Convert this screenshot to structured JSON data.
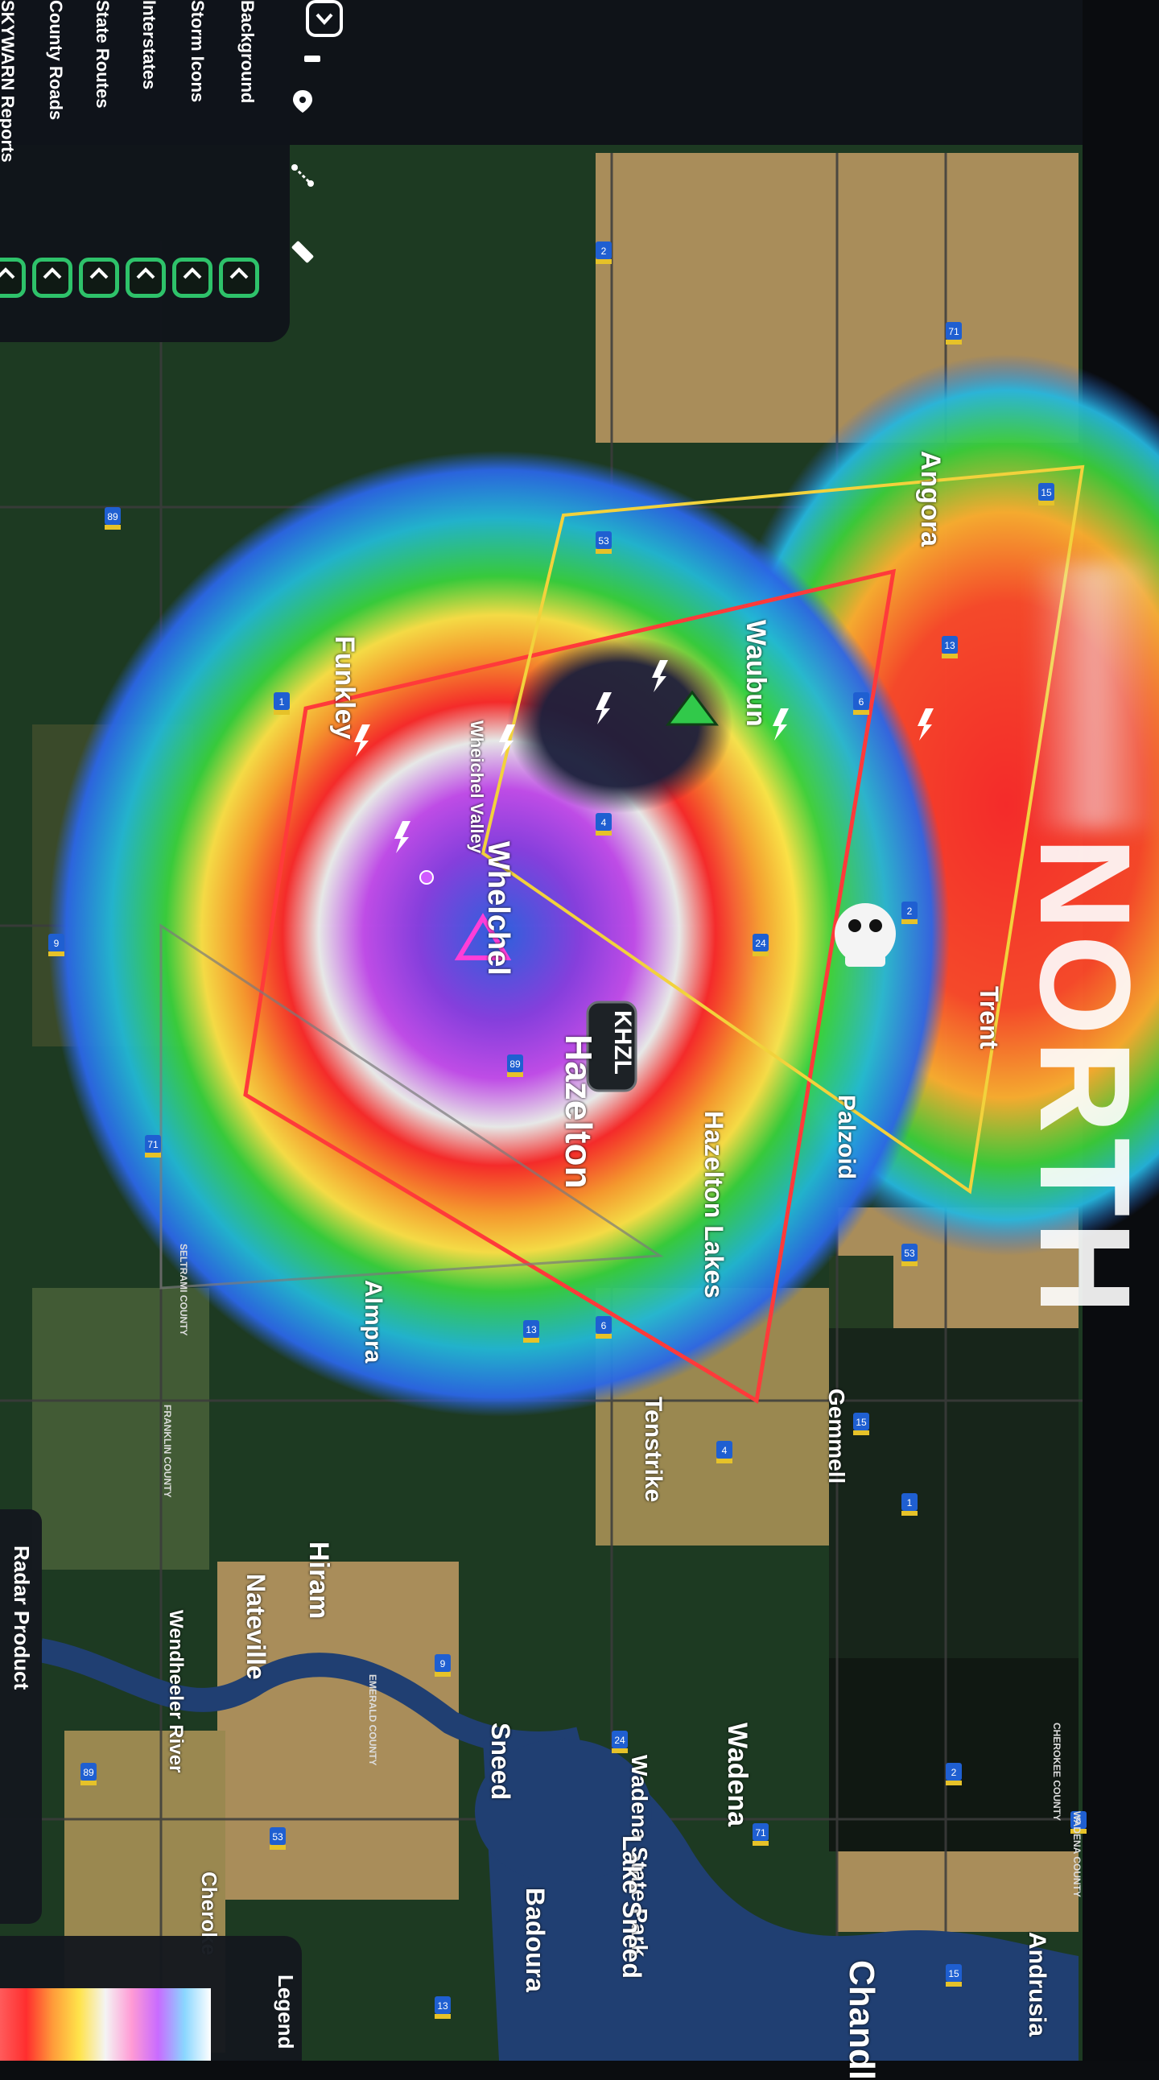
{
  "layers": {
    "items": [
      {
        "label": "Background"
      },
      {
        "label": "Storm Icons"
      },
      {
        "label": "Interstates"
      },
      {
        "label": "State Routes"
      },
      {
        "label": "County Roads"
      },
      {
        "label": "SKYWARN Reports"
      }
    ],
    "tools": [
      "pin-icon",
      "measure-icon",
      "ruler-icon",
      "hide-icon"
    ]
  },
  "radar_site": {
    "label": "KHZL"
  },
  "towns": [
    {
      "name": "Angora"
    },
    {
      "name": "Waubun"
    },
    {
      "name": "Funkley"
    },
    {
      "name": "Wheichel Valley"
    },
    {
      "name": "Whelchel"
    },
    {
      "name": "Trent"
    },
    {
      "name": "Palzoid"
    },
    {
      "name": "Hazelton"
    },
    {
      "name": "Hazelton Lakes"
    },
    {
      "name": "Almpra"
    },
    {
      "name": "Gemmell"
    },
    {
      "name": "Tenstrike"
    },
    {
      "name": "Hiram"
    },
    {
      "name": "Nateville"
    },
    {
      "name": "Wendheeler River"
    },
    {
      "name": "Sneed"
    },
    {
      "name": "Wadena"
    },
    {
      "name": "Wadena State Park"
    },
    {
      "name": "Lake Sneed"
    },
    {
      "name": "Badoura"
    },
    {
      "name": "Cheroke"
    },
    {
      "name": "Andrusia"
    },
    {
      "name": "Chandl"
    }
  ],
  "county_labels": [
    {
      "text": "WADENA COUNTY"
    },
    {
      "text": "CHEROKEE COUNTY"
    },
    {
      "text": "EMERALD COUNTY"
    },
    {
      "text": "SELTRAMI COUNTY"
    },
    {
      "text": "FRANKLIN COUNTY"
    }
  ],
  "route_shields": [
    "2",
    "71",
    "89",
    "53",
    "15",
    "13",
    "6",
    "1",
    "4",
    "9",
    "24"
  ],
  "radar_product": {
    "label": "Radar Product"
  },
  "legend": {
    "label": "Legend"
  },
  "overlay_text": {
    "north": "NORTH"
  },
  "colors": {
    "panel_bg": "#10141a",
    "toggle_green": "#2ec26a",
    "warning_red": "#ff3a3a",
    "warning_yellow": "#f2d23c",
    "land_dark": "#1d3a22",
    "land_tan": "#a98d5a"
  }
}
